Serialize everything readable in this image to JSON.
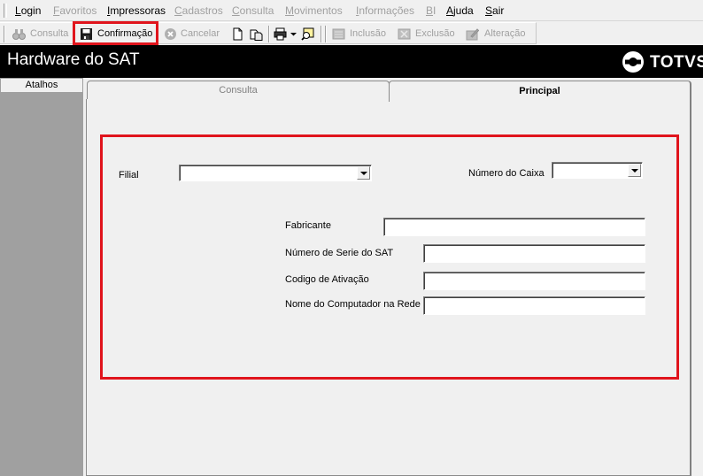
{
  "menu": {
    "items": [
      {
        "label": "Login",
        "enabled": true
      },
      {
        "label": "Favoritos",
        "enabled": false
      },
      {
        "label": "Impressoras",
        "enabled": true
      },
      {
        "label": "Cadastros",
        "enabled": false
      },
      {
        "label": "Consulta",
        "enabled": false
      },
      {
        "label": "Movimentos",
        "enabled": false
      },
      {
        "label": "Informações",
        "enabled": false
      },
      {
        "label": "BI",
        "enabled": false
      },
      {
        "label": "Ajuda",
        "enabled": true
      },
      {
        "label": "Sair",
        "enabled": true
      }
    ]
  },
  "toolbar": {
    "consulta": "Consulta",
    "confirmacao": "Confirmação",
    "cancelar": "Cancelar",
    "inclusao": "Inclusão",
    "exclusao": "Exclusão",
    "alteracao": "Alteração",
    "icons": [
      "binoculars-icon",
      "save-icon",
      "cancel-icon",
      "new-document-icon",
      "copy-document-icon",
      "printer-icon",
      "chevron-down-icon",
      "help-search-icon",
      "add-record-icon",
      "delete-record-icon",
      "edit-record-icon"
    ]
  },
  "header": {
    "title": "Hardware do SAT",
    "brand": "TOTVS"
  },
  "sidebar": {
    "title": "Atalhos"
  },
  "tabs": [
    {
      "label": "Consulta",
      "active": false
    },
    {
      "label": "Principal",
      "active": true
    }
  ],
  "form": {
    "filial_label": "Filial",
    "filial_value": "",
    "numero_caixa_label": "Número do Caixa",
    "numero_caixa_value": "",
    "fabricante_label": "Fabricante",
    "fabricante_value": "",
    "serie_label": "Número de Serie do SAT",
    "serie_value": "",
    "ativacao_label": "Codigo de Ativação",
    "ativacao_value": "",
    "computador_label": "Nome do Computador na Rede",
    "computador_value": ""
  },
  "colors": {
    "highlight": "#e0141c",
    "title_bar": "#000000",
    "side_panel": "#a0a0a0"
  }
}
